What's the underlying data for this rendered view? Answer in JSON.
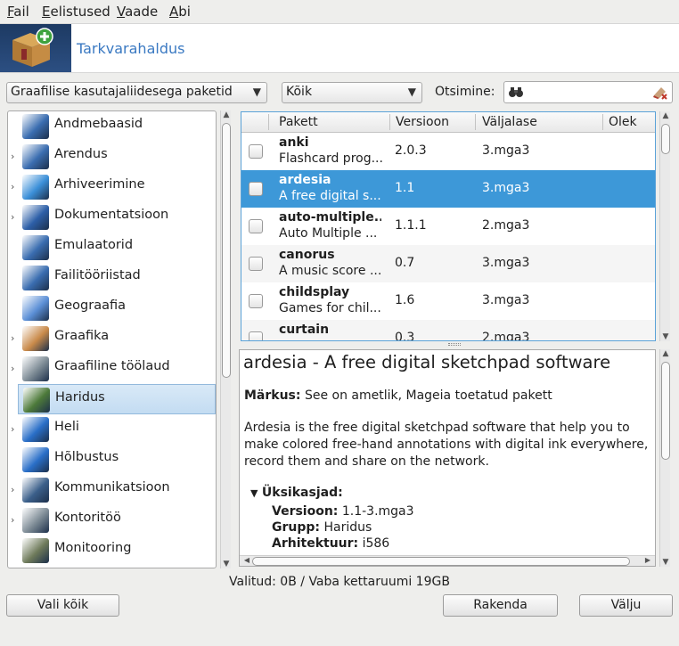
{
  "menubar": {
    "items": [
      {
        "label": "Fail",
        "underline": "F",
        "rest": "ail"
      },
      {
        "label": "Eelistused",
        "underline": "E",
        "rest": "elistused"
      },
      {
        "label": "Vaade",
        "underline": "V",
        "rest": "aade"
      },
      {
        "label": "Abi",
        "underline": "A",
        "rest": "bi"
      }
    ]
  },
  "banner": {
    "title": "Tarkvarahaldus",
    "icon": "package-add-icon"
  },
  "filters": {
    "type_filter": "Graafilise kasutajaliidesega paketid",
    "status_filter": "Kõik",
    "search_label": "Otsimine:",
    "search_value": ""
  },
  "categories": [
    {
      "label": "Andmebaasid",
      "icon": "database-icon",
      "expander": false,
      "color": "#3a6db0"
    },
    {
      "label": "Arendus",
      "icon": "development-icon",
      "expander": true,
      "color": "#3a6db0"
    },
    {
      "label": "Arhiveerimine",
      "icon": "archive-icon",
      "expander": true,
      "color": "#3b8fd8"
    },
    {
      "label": "Dokumentatsioon",
      "icon": "book-icon",
      "expander": true,
      "color": "#2d5fa8"
    },
    {
      "label": "Emulaatorid",
      "icon": "emulator-icon",
      "expander": false,
      "color": "#3a6db0"
    },
    {
      "label": "Failitööriistad",
      "icon": "file-tools-icon",
      "expander": false,
      "color": "#3a6db0"
    },
    {
      "label": "Geograafia",
      "icon": "flask-icon",
      "expander": false,
      "color": "#5b8fd6"
    },
    {
      "label": "Graafika",
      "icon": "palette-icon",
      "expander": true,
      "color": "#c98a4a"
    },
    {
      "label": "Graafiline töölaud",
      "icon": "desktop-icon",
      "expander": true,
      "color": "#7d8b95"
    },
    {
      "label": "Haridus",
      "icon": "education-icon",
      "expander": false,
      "color": "#4d7a3a",
      "selected": true
    },
    {
      "label": "Heli",
      "icon": "speaker-icon",
      "expander": true,
      "color": "#2a6fc8"
    },
    {
      "label": "Hõlbustus",
      "icon": "accessibility-icon",
      "expander": false,
      "color": "#2a6fc8"
    },
    {
      "label": "Kommunikatsioon",
      "icon": "network-icon",
      "expander": true,
      "color": "#3b5f8a"
    },
    {
      "label": "Kontoritöö",
      "icon": "typewriter-icon",
      "expander": true,
      "color": "#7d8b95"
    },
    {
      "label": "Monitooring",
      "icon": "monitor-icon",
      "expander": false,
      "color": "#6e7a5a"
    }
  ],
  "table": {
    "headers": {
      "pkg": "Pakett",
      "ver": "Versioon",
      "rel": "Väljalase",
      "status": "Olek"
    },
    "rows": [
      {
        "name": "anki",
        "desc": "Flashcard prog...",
        "version": "2.0.3",
        "release": "3.mga3"
      },
      {
        "name": "ardesia",
        "desc": "A free digital s...",
        "version": "1.1",
        "release": "3.mga3",
        "selected": true
      },
      {
        "name": "auto-multiple...",
        "desc": "Auto Multiple ...",
        "version": "1.1.1",
        "release": "2.mga3"
      },
      {
        "name": "canorus",
        "desc": "A music score ...",
        "version": "0.7",
        "release": "3.mga3"
      },
      {
        "name": "childsplay",
        "desc": "Games for chil...",
        "version": "1.6",
        "release": "3.mga3"
      },
      {
        "name": "curtain",
        "desc": "",
        "version": "0.3",
        "release": "2.mga3"
      }
    ]
  },
  "details": {
    "title": "ardesia - A free digital sketchpad software",
    "note_label": "Märkus:",
    "note_text": " See on ametlik, Mageia toetatud pakett",
    "desc_line1": "Ardesia is the free digital sketchpad software that help you to",
    "desc_line2": "make colored free-hand annotations with digital ink everywhere,",
    "desc_line3": "record them and share on the network.",
    "section": "Üksikasjad:",
    "version_label": "Versioon:",
    "version_value": " 1.1-3.mga3",
    "group_label": "Grupp:",
    "group_value": " Haridus",
    "arch_label": "Arhitektuur:",
    "arch_value": " i586"
  },
  "status_text": "Valitud: 0B / Vaba kettaruumi 19GB",
  "buttons": {
    "select_all": "Vali kõik",
    "apply": "Rakenda",
    "quit": "Välju"
  }
}
